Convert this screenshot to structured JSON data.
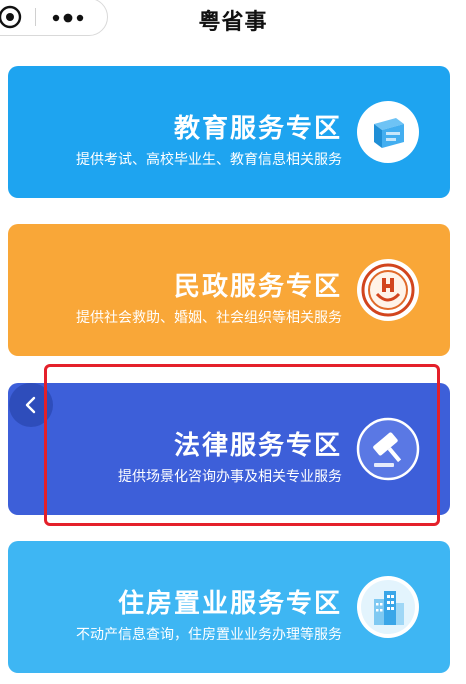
{
  "app": {
    "title": "粤省事"
  },
  "cards": [
    {
      "title": "教育服务专区",
      "subtitle": "提供考试、高校毕业生、教育信息相关服务",
      "icon": "education-icon",
      "color": "#1ea4f0"
    },
    {
      "title": "民政服务专区",
      "subtitle": "提供社会救助、婚姻、社会组织等相关服务",
      "icon": "civil-affairs-emblem-icon",
      "color": "#f9a738"
    },
    {
      "title": "法律服务专区",
      "subtitle": "提供场景化咨询办事及相关专业服务",
      "icon": "gavel-icon",
      "color": "#3d5fd9"
    },
    {
      "title": "住房置业服务专区",
      "subtitle": "不动产信息查询，住房置业业务办理等服务",
      "icon": "building-icon",
      "color": "#3eb6f3"
    }
  ],
  "highlight_color": "#e4202a"
}
